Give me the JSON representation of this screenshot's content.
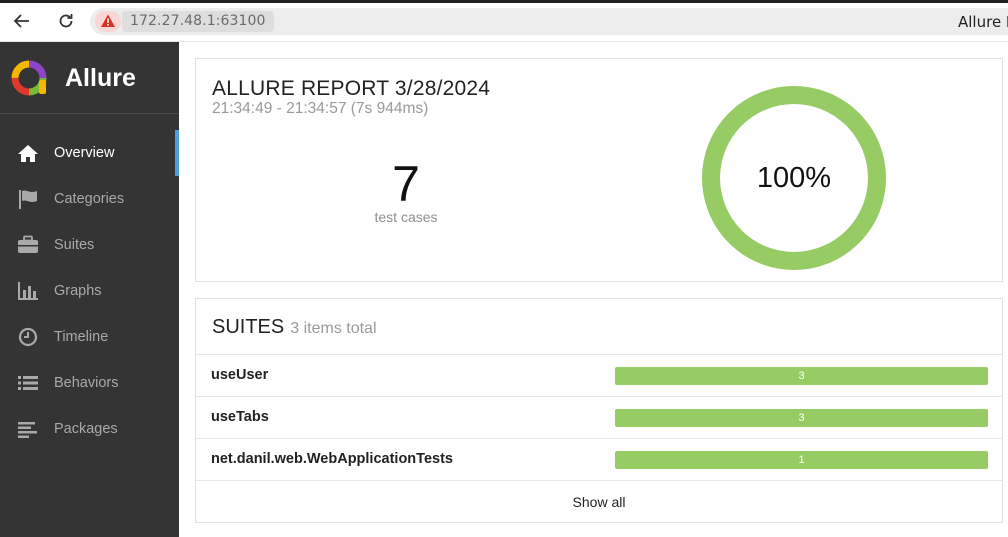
{
  "browser": {
    "url": "172.27.48.1:63100",
    "tab_title": "Allure R"
  },
  "sidebar": {
    "brand": "Allure",
    "items": [
      {
        "label": "Overview",
        "icon": "home-icon",
        "active": true
      },
      {
        "label": "Categories",
        "icon": "flag-icon",
        "active": false
      },
      {
        "label": "Suites",
        "icon": "briefcase-icon",
        "active": false
      },
      {
        "label": "Graphs",
        "icon": "bar-chart-icon",
        "active": false
      },
      {
        "label": "Timeline",
        "icon": "clock-icon",
        "active": false
      },
      {
        "label": "Behaviors",
        "icon": "list-icon",
        "active": false
      },
      {
        "label": "Packages",
        "icon": "align-left-icon",
        "active": false
      }
    ]
  },
  "summary": {
    "title": "ALLURE REPORT 3/28/2024",
    "time_range": "21:34:49 - 21:34:57 (7s 944ms)",
    "test_case_count": "7",
    "test_case_label": "test cases",
    "pass_rate_label": "100%",
    "pass_rate": 1.0
  },
  "suites": {
    "title": "SUITES",
    "count_label": "3 items total",
    "rows": [
      {
        "name": "useUser",
        "count": "3"
      },
      {
        "name": "useTabs",
        "count": "3"
      },
      {
        "name": "net.danil.web.WebApplicationTests",
        "count": "1"
      }
    ],
    "show_all_label": "Show all"
  },
  "colors": {
    "sidebar_bg": "#343434",
    "passed": "#97cc64",
    "active_indicator": "#4a9fe0"
  }
}
